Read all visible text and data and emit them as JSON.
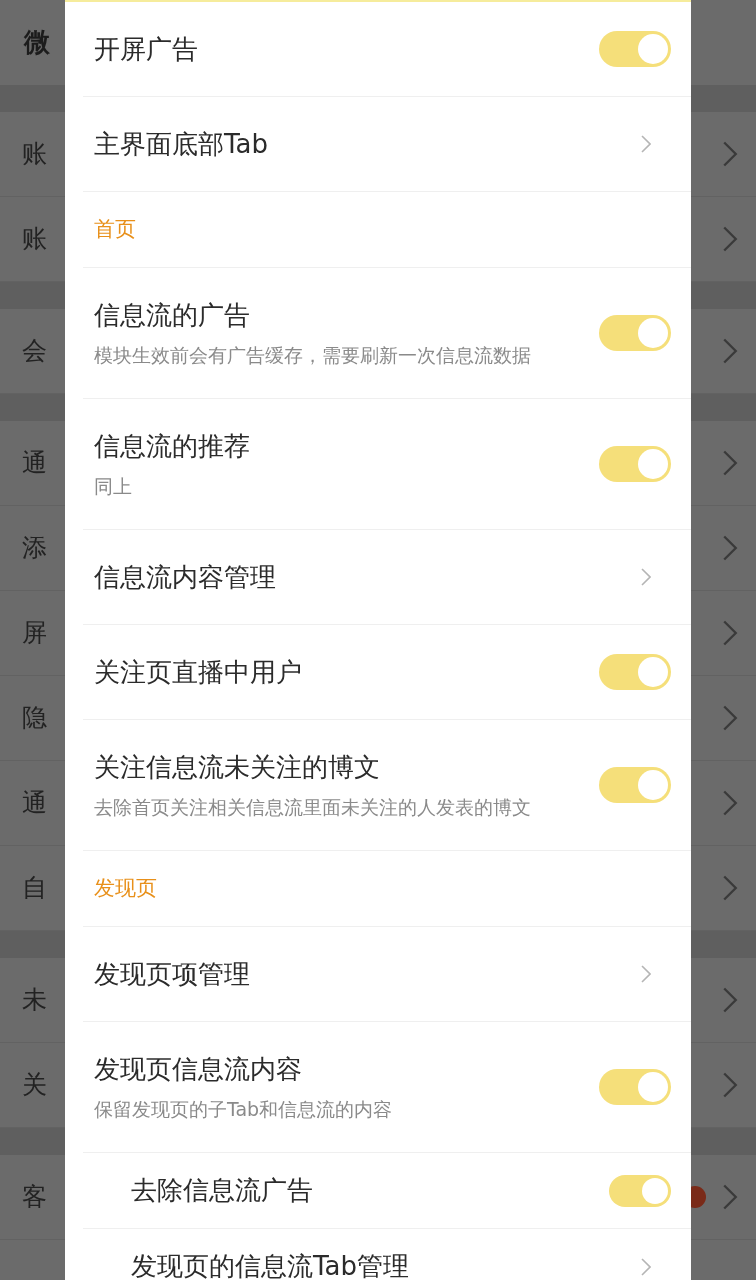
{
  "background": {
    "title": "微",
    "groups": [
      [
        {
          "label": "账"
        },
        {
          "label": "账"
        }
      ],
      [
        {
          "label": "会"
        }
      ],
      [
        {
          "label": "通"
        },
        {
          "label": "添"
        },
        {
          "label": "屏"
        },
        {
          "label": "隐"
        },
        {
          "label": "通"
        },
        {
          "label": "自"
        }
      ],
      [
        {
          "label": "未"
        },
        {
          "label": "关"
        }
      ],
      [
        {
          "label": "客",
          "dot": true
        }
      ]
    ]
  },
  "dialog": {
    "items": [
      {
        "kind": "toggle",
        "title": "开屏广告",
        "on": true
      },
      {
        "kind": "link",
        "title": "主界面底部Tab"
      },
      {
        "kind": "header",
        "title": "首页"
      },
      {
        "kind": "toggle",
        "title": "信息流的广告",
        "subtitle": "模块生效前会有广告缓存，需要刷新一次信息流数据",
        "on": true
      },
      {
        "kind": "toggle",
        "title": "信息流的推荐",
        "subtitle": "同上",
        "on": true
      },
      {
        "kind": "link",
        "title": "信息流内容管理"
      },
      {
        "kind": "toggle",
        "title": "关注页直播中用户",
        "on": true
      },
      {
        "kind": "toggle",
        "title": "关注信息流未关注的博文",
        "subtitle": "去除首页关注相关信息流里面未关注的人发表的博文",
        "on": true
      },
      {
        "kind": "header",
        "title": "发现页"
      },
      {
        "kind": "link",
        "title": "发现页项管理"
      },
      {
        "kind": "toggle",
        "title": "发现页信息流内容",
        "subtitle": "保留发现页的子Tab和信息流的内容",
        "on": true,
        "children": [
          {
            "kind": "toggle",
            "title": "去除信息流广告",
            "on": true
          },
          {
            "kind": "link",
            "title": "发现页的信息流Tab管理"
          }
        ]
      }
    ]
  }
}
